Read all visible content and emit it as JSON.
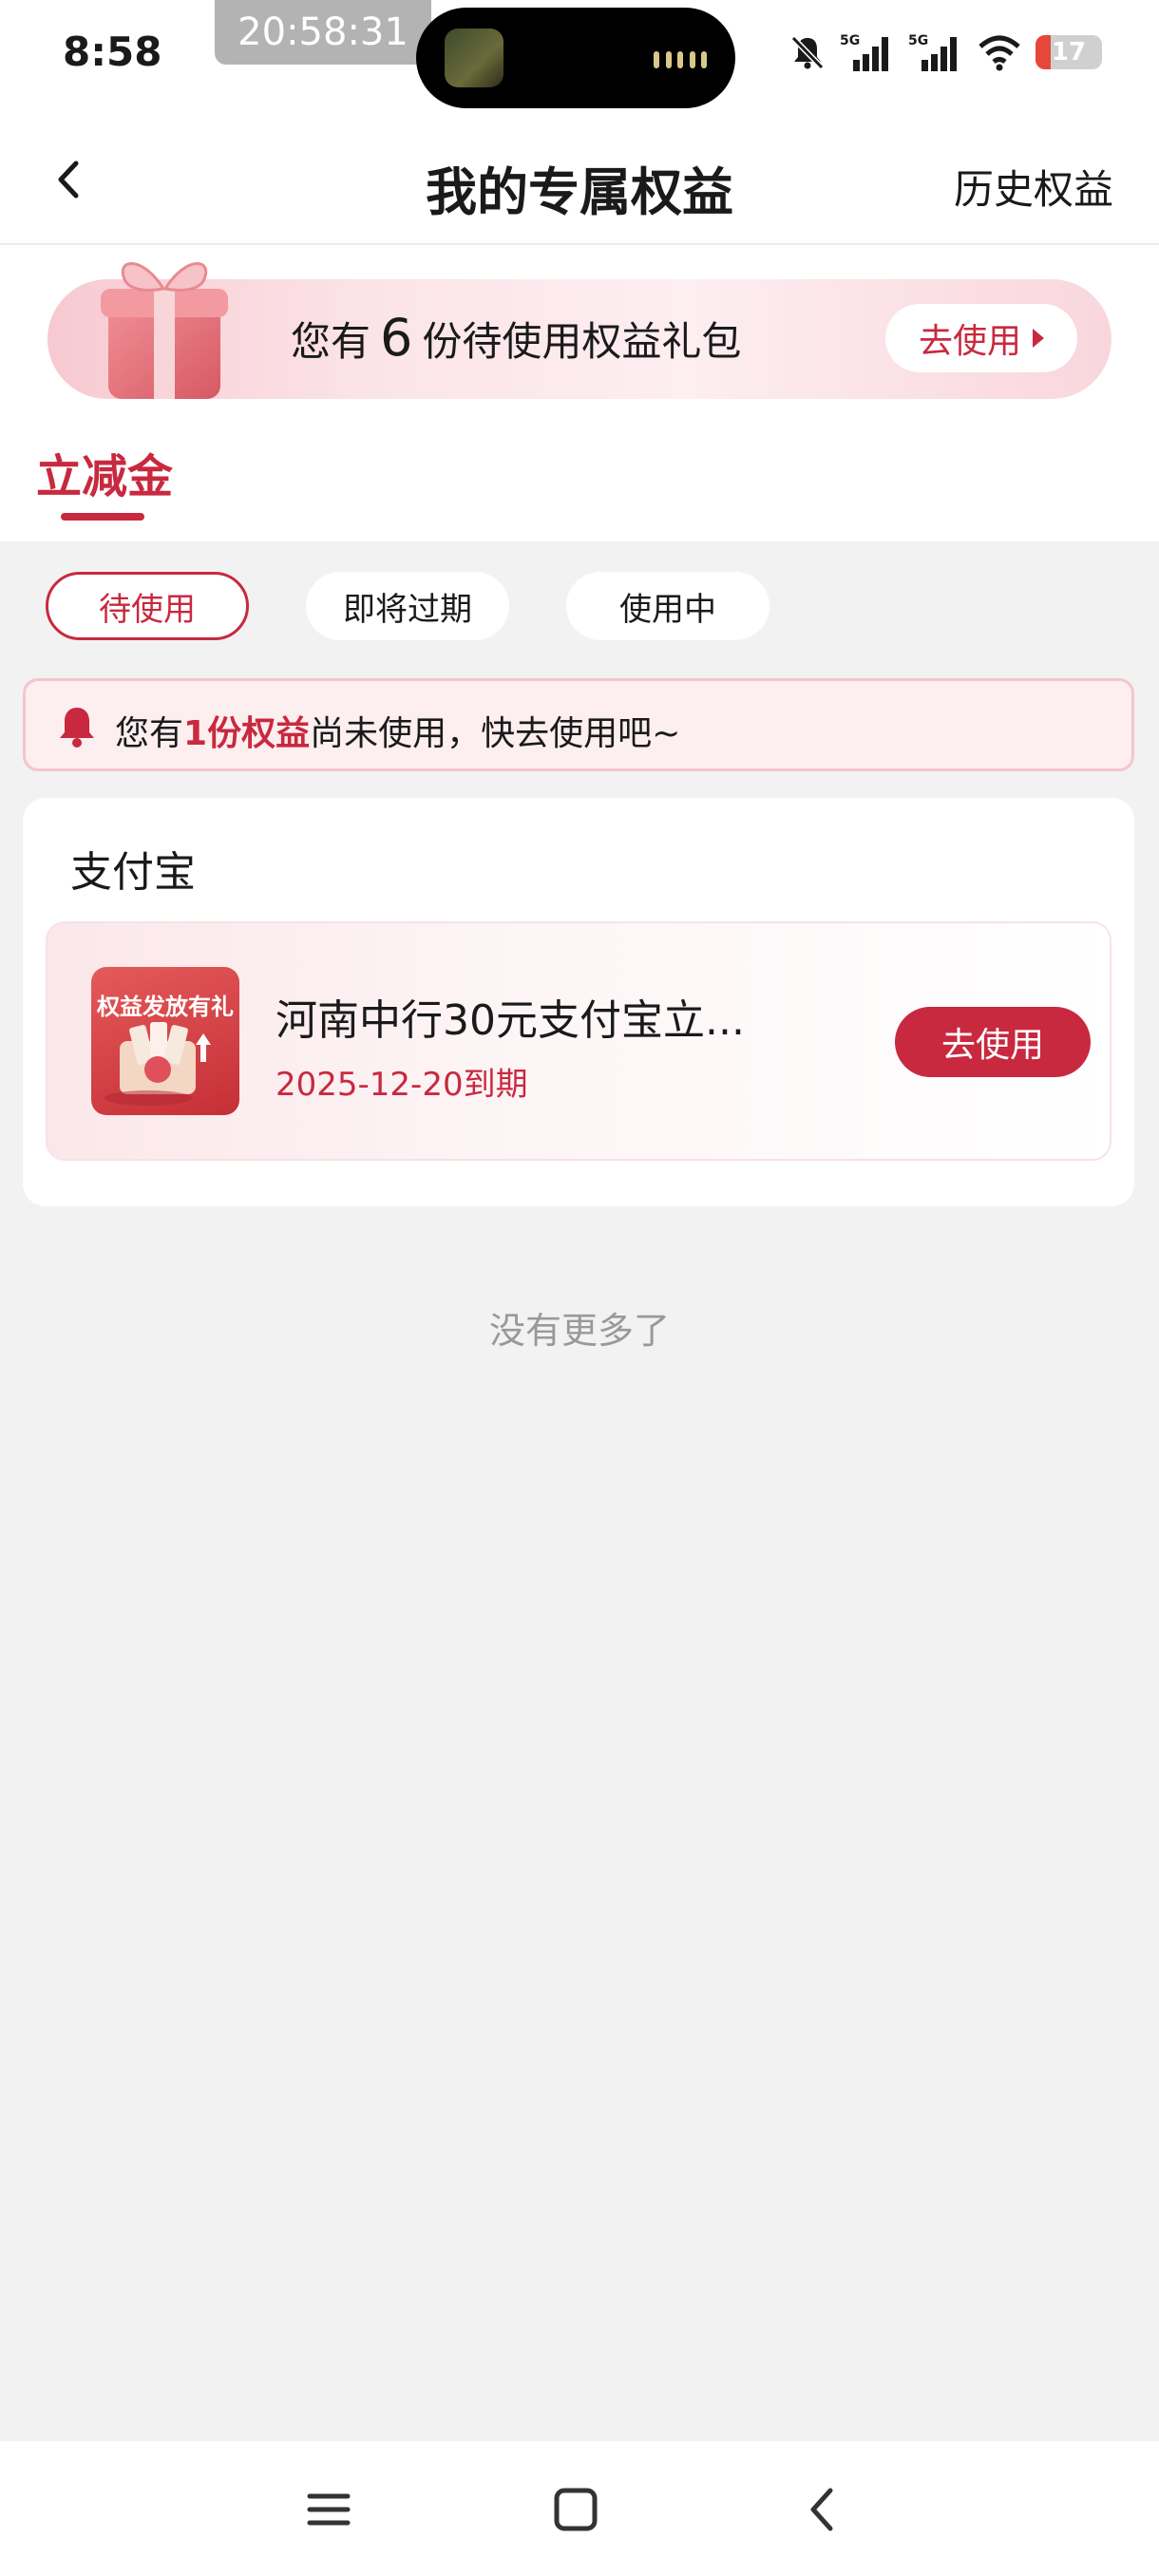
{
  "status_bar": {
    "time": "8:58",
    "recording_time": "20:58:31",
    "battery": "17",
    "network_label": "5G"
  },
  "nav": {
    "title": "我的专属权益",
    "history": "历史权益"
  },
  "promo": {
    "prefix": "您有",
    "count": "6",
    "suffix": "份待使用权益礼包",
    "button": "去使用"
  },
  "tabs": [
    {
      "label": "立减金",
      "active": true
    }
  ],
  "filters": [
    {
      "label": "待使用",
      "active": true
    },
    {
      "label": "即将过期",
      "active": false
    },
    {
      "label": "使用中",
      "active": false
    }
  ],
  "notice": {
    "prefix": "您有",
    "highlight": "1份权益",
    "suffix": "尚未使用，快去使用吧~"
  },
  "groups": [
    {
      "title": "支付宝",
      "items": [
        {
          "icon_label": "权益发放有礼",
          "name": "河南中行30元支付宝立...",
          "expiry": "2025-12-20到期",
          "button": "去使用"
        }
      ]
    }
  ],
  "footer": "没有更多了",
  "colors": {
    "accent": "#c8293f",
    "background": "#f2f2f2"
  }
}
